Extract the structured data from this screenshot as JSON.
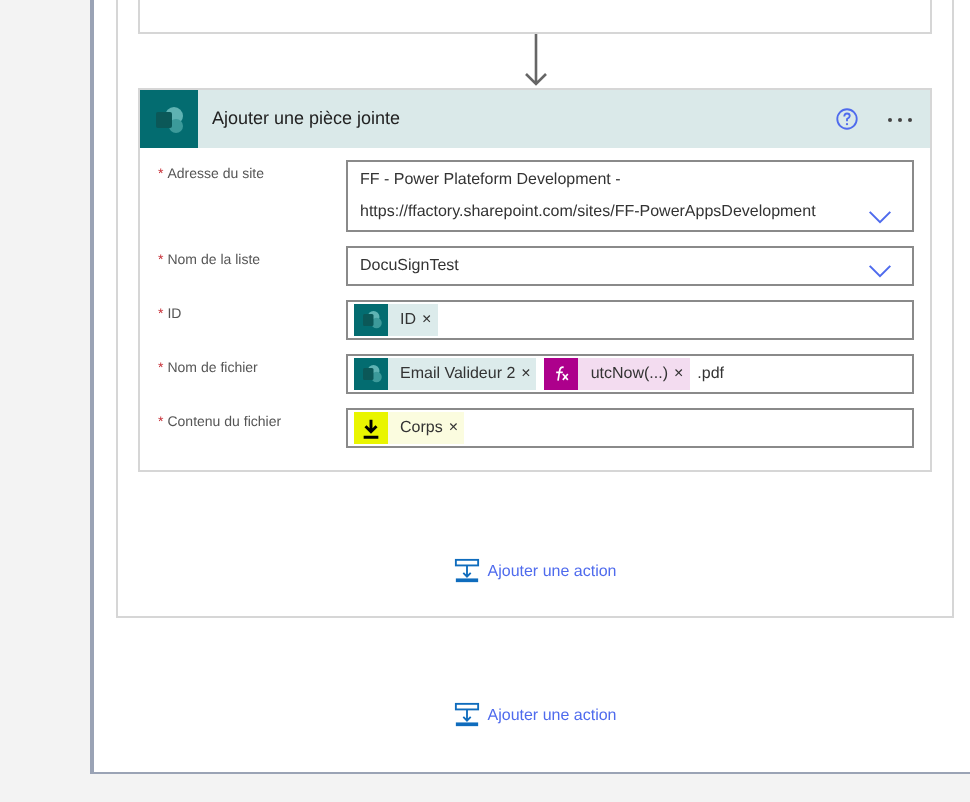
{
  "action_card": {
    "title": "Ajouter une pièce jointe",
    "fields": [
      {
        "label": "Adresse du site",
        "required_mark": "*",
        "kind": "dropdown",
        "lines": [
          "FF - Power Plateform Development -",
          "https://ffactory.sharepoint.com/sites/FF-PowerAppsDevelopment"
        ]
      },
      {
        "label": "Nom de la liste",
        "required_mark": "*",
        "kind": "dropdown",
        "lines": [
          "DocuSignTest"
        ]
      },
      {
        "label": "ID",
        "required_mark": "*",
        "kind": "tokens",
        "parts": [
          {
            "kind": "sharepoint",
            "text": "ID",
            "remove": "×"
          }
        ]
      },
      {
        "label": "Nom de fichier",
        "required_mark": "*",
        "kind": "tokens",
        "parts": [
          {
            "kind": "sharepoint",
            "text": "Email Valideur 2",
            "remove": "×"
          },
          {
            "kind": "expression",
            "text": "utcNow(...)",
            "remove": "×"
          },
          {
            "kind": "text",
            "text": ".pdf"
          }
        ]
      },
      {
        "label": "Contenu du fichier",
        "required_mark": "*",
        "kind": "tokens",
        "parts": [
          {
            "kind": "download",
            "text": "Corps",
            "remove": "×"
          }
        ]
      }
    ]
  },
  "add_actions": [
    "Ajouter une action",
    "Ajouter une action"
  ]
}
